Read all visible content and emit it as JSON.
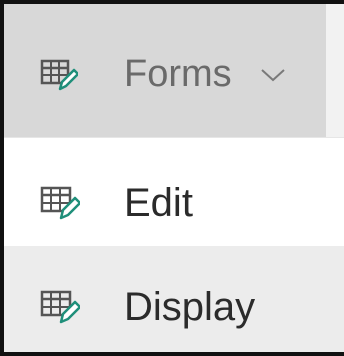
{
  "toolbar": {
    "forms_label": "Forms",
    "forms_icon": "form-table-edit-icon",
    "chevron_icon": "chevron-down-icon"
  },
  "menu": {
    "items": [
      {
        "label": "Edit",
        "icon": "form-table-edit-icon"
      },
      {
        "label": "Display",
        "icon": "form-table-edit-icon"
      }
    ]
  },
  "colors": {
    "toolbar_bg": "#f2f2f2",
    "button_bg": "#d8d8d8",
    "hover_bg": "#ececec",
    "text_muted": "#6a6a6a",
    "text_dark": "#2b2b2b",
    "icon_accent": "#1f8f7a"
  }
}
